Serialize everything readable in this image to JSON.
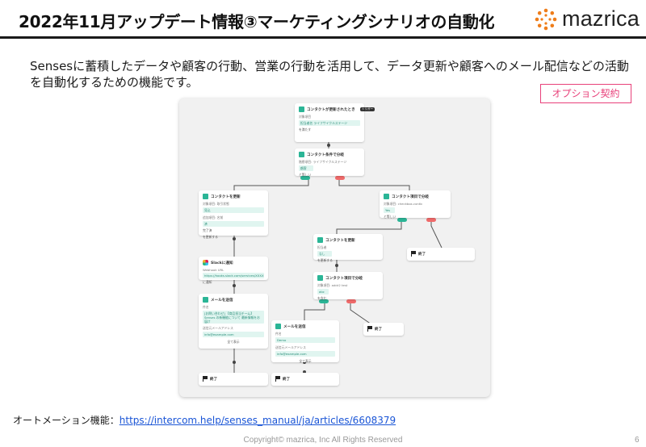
{
  "header": {
    "title": "2022年11月アップデート情報③マーケティングシナリオの自動化",
    "logo_text": "mazrica",
    "brand_color": "#ef7d1a"
  },
  "description": "Sensesに蓄積したデータや顧客の行動、営業の行動を活用して、データ更新や顧客へのメール配信などの活動を自動化するための機能です。",
  "option_badge": "オプション契約",
  "flow": {
    "trigger": {
      "title": "コンタクトが更新されたとき",
      "badge": "トリガー",
      "label": "対象項目",
      "value": "担当者名 ライフサイクルステージ",
      "note": "を満たす"
    },
    "branch1": {
      "title": "コンタクト条件で分岐",
      "label": "階層項目: ライフサイクルステージ",
      "value": "顧客",
      "note": "と等しい"
    },
    "update_contact": {
      "title": "コンタクトを更新",
      "label1": "対象項目: 取引状態",
      "value1": "見込",
      "label2": "追加項目: 名前",
      "value2": "済",
      "note1": "完了済",
      "note2": "を更新する"
    },
    "branch2": {
      "title": "コンタクト項目で分岐",
      "label": "対象項目: checkbox-contb",
      "value": "Yes",
      "note": "と等しい"
    },
    "update_contact2": {
      "title": "コンタクトを更新",
      "label": "担当者",
      "value": "なし",
      "note": "を更新する"
    },
    "end_right": {
      "title": "終了"
    },
    "slack": {
      "title": "Slackに通知",
      "label": "Webhook URL",
      "value": "https://hooks.slack.com/services/XXXX",
      "note": "に通知"
    },
    "branch3": {
      "title": "コンタクト項目で分岐",
      "label": "対象項目: addr2 test",
      "value": "abc",
      "note": "を含む"
    },
    "email1": {
      "title": "メールを送信",
      "label1": "件名",
      "value1": "[お問い合わせ] 【商品担当チーム】 Senses の新機能について 最新情報をお届け",
      "label2": "送信元メールアドレス",
      "value2": "info@example.com",
      "more": "全て表示"
    },
    "end_mid": {
      "title": "終了"
    },
    "email2": {
      "title": "メールを送信",
      "label1": "件名",
      "value1": "Demo",
      "label2": "送信元メールアドレス",
      "value2": "info@example.com",
      "more": "全て表示"
    },
    "end_left": {
      "title": "終了"
    },
    "end_bottom": {
      "title": "終了"
    }
  },
  "footer": {
    "label": "オートメーション機能：",
    "link": "https://intercom.help/senses_manual/ja/articles/6608379",
    "copyright": "Copyright© mazrica, Inc All Rights Reserved",
    "page": "6"
  }
}
